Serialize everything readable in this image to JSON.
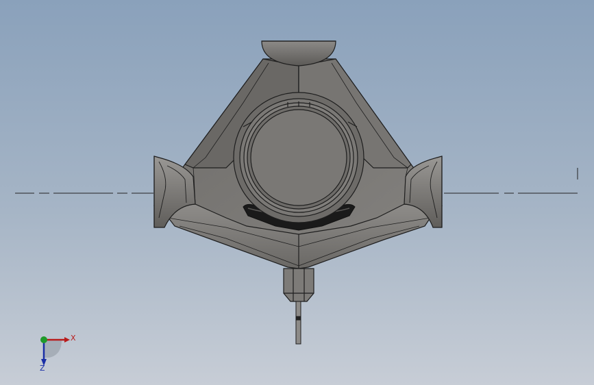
{
  "viewport": {
    "background_top": "#8aa1bb",
    "background_bottom": "#c7cdd6"
  },
  "model": {
    "part_color": "#7a7875",
    "edge_color": "#1e1e1e"
  },
  "triad": {
    "x_label": "X",
    "z_label": "Z",
    "x_color": "#b81c1c",
    "y_color": "#1f9a2a",
    "z_color": "#1a2fa6"
  }
}
